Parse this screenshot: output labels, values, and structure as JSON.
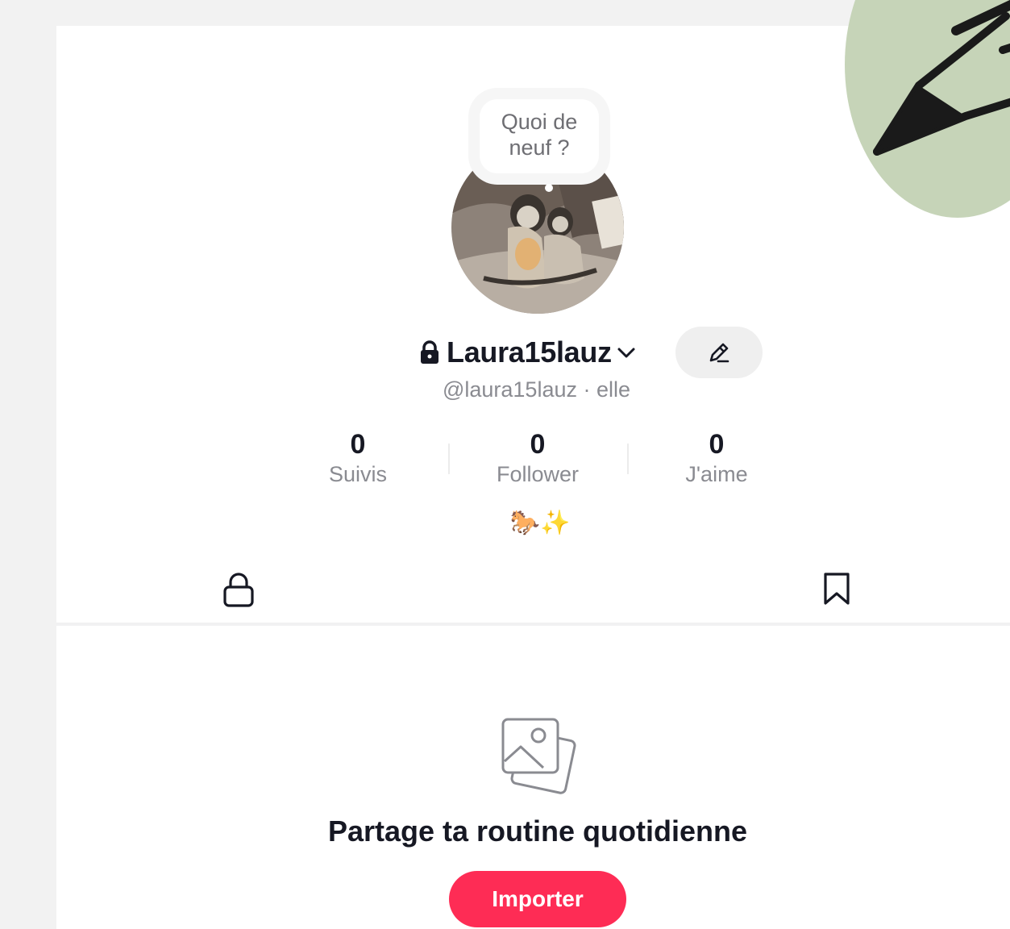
{
  "profile": {
    "status_bubble": "Quoi de neuf ?",
    "display_name": "Laura15lauz",
    "handle": "@laura15lauz · elle",
    "bio": "🐎✨"
  },
  "stats": [
    {
      "value": "0",
      "label": "Suivis"
    },
    {
      "value": "0",
      "label": "Follower"
    },
    {
      "value": "0",
      "label": "J'aime"
    }
  ],
  "icons": {
    "private_lock": "lock-icon",
    "username_menu": "chevron-down-icon",
    "edit": "pencil-icon",
    "private_tab": "lock-tab-icon",
    "saved_tab": "bookmark-icon",
    "empty_state": "photos-icon"
  },
  "empty_state": {
    "title": "Partage ta routine quotidienne",
    "button_label": "Importer"
  },
  "colors": {
    "accent": "#fe2c55",
    "decor_green": "#c6d4b8",
    "muted_text": "#8a8b91"
  }
}
